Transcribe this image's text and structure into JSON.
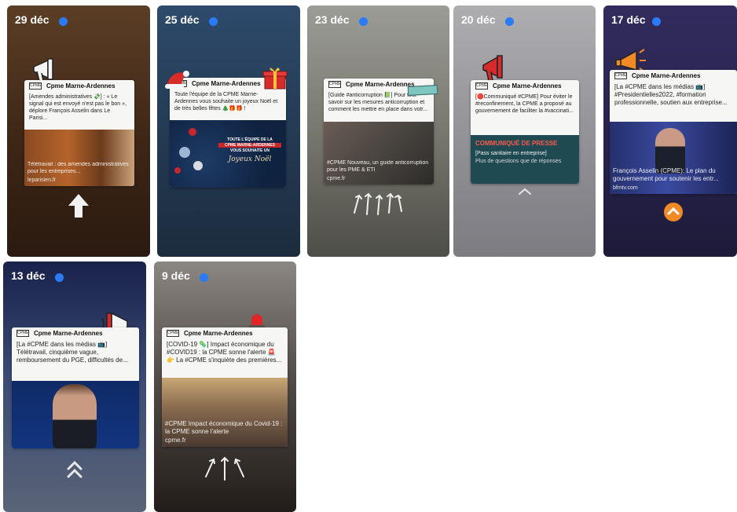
{
  "stories": [
    {
      "date": "29 déc",
      "account": "Cpme Marne-Ardennes",
      "text": "[Amendes administratives 💸] : « Le signal qui est envoyé n'est pas le bon », déplore François Asselin dans Le Parisi...",
      "caption": "Télétravail : des amendes administratives pour les entreprises...",
      "source": "leparisien.fr",
      "sticker": "megaphone-icon",
      "control": "up-arrow-icon"
    },
    {
      "date": "25 déc",
      "account": "Cpme Marne-Ardennes",
      "text": "Toute l'équipe de la CPME Marne-Ardennes vous souhaite un joyeux Noël et de très belles fêtes 🎄🎁🎁 !",
      "poster_lines": [
        "TOUTE L'ÉQUIPE DE LA",
        "CPME MARNE-ARDENNES",
        "VOUS SOUHAITE UN",
        "Joyeux Noël"
      ],
      "sticker": "gift-icon",
      "control": ""
    },
    {
      "date": "23 déc",
      "account": "Cpme Marne-Ardennes",
      "text": "[Guide #anticorruption 📗] Pour tout savoir sur les mesures anticorruption et comment les mettre en place dans votr...",
      "caption": "#CPME Nouveau, un guide anticorruption pour les PME & ETI",
      "source": "cpme.fr",
      "sticker": "",
      "control": "arrows-up-icon"
    },
    {
      "date": "20 déc",
      "account": "Cpme Marne-Ardennes",
      "text": "[🔴Communiqué #CPME] Pour éviter le #reconfinement, la CPME a proposé au gouvernement de faciliter la #vaccinati...",
      "press_title": "COMMUNIQUÉ DE PRESSE",
      "press_sub": "[Pass sanitaire en entreprise]",
      "press_sub2": "Plus de questions que de réponses",
      "sticker": "megaphone-icon",
      "control": "chevron-up-icon"
    },
    {
      "date": "17 déc",
      "account": "Cpme Marne-Ardennes",
      "text": "[La #CPME dans les médias 📺] #Presidentielles2022, #formation professionnelle, soutien aux entreprise...",
      "caption": "François Asselin (CPME): Le plan du gouvernement pour soutenir les entr...",
      "source": "bfmtv.com",
      "sticker": "megaphone-icon",
      "control": "chevron-up-circle-icon"
    },
    {
      "date": "13 déc",
      "account": "Cpme Marne-Ardennes",
      "text": "[La #CPME dans les médias 📺] Télétravail, cinquième vague, remboursement du PGE, difficultés de...",
      "sticker": "megaphone-icon",
      "control": "double-chevron-up-icon"
    },
    {
      "date": "9 déc",
      "account": "Cpme Marne-Ardennes",
      "text": "[COVID-19 🦠] Impact économique du #COVID19 : la CPME sonne l'alerte 🚨 👉 La #CPME s'inquiète des premières...",
      "caption": "#CPME Impact économique du Covid-19 : la CPME sonne l'alerte",
      "source": "cpme.fr",
      "sticker": "siren-icon",
      "control": "arrows-up-icon"
    }
  ],
  "colors": {
    "dot": "#2a7cf6",
    "accent_orange": "#f08a24",
    "press_red": "#d9322e"
  }
}
